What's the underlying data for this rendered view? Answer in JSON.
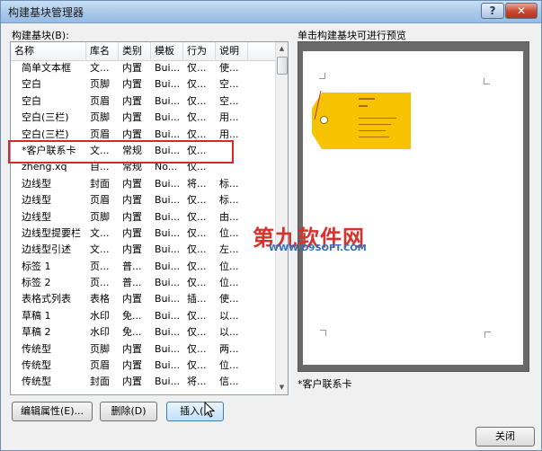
{
  "window": {
    "title": "构建基块管理器",
    "help_label": "?",
    "close_label": "✕"
  },
  "list": {
    "label": "构建基块(B):",
    "columns": [
      "名称",
      "库名",
      "类别",
      "模板",
      "行为",
      "说明"
    ],
    "rows": [
      [
        "简单文本框",
        "文...",
        "内置",
        "Bui...",
        "仅...",
        "使..."
      ],
      [
        "空白",
        "页脚",
        "内置",
        "Bui...",
        "仅...",
        "空..."
      ],
      [
        "空白",
        "页眉",
        "内置",
        "Bui...",
        "仅...",
        "空..."
      ],
      [
        "空白(三栏)",
        "页脚",
        "内置",
        "Bui...",
        "仅...",
        "用..."
      ],
      [
        "空白(三栏)",
        "页眉",
        "内置",
        "Bui...",
        "仅...",
        "用..."
      ],
      [
        "*客户联系卡",
        "文...",
        "常规",
        "Bui...",
        "仅...",
        ""
      ],
      [
        "zheng.xq",
        "自...",
        "常规",
        "No...",
        "仅...",
        ""
      ],
      [
        "边线型",
        "封面",
        "内置",
        "Bui...",
        "将...",
        "标..."
      ],
      [
        "边线型",
        "页眉",
        "内置",
        "Bui...",
        "仅...",
        "标..."
      ],
      [
        "边线型",
        "页脚",
        "内置",
        "Bui...",
        "仅...",
        "由..."
      ],
      [
        "边线型提要栏",
        "文...",
        "内置",
        "Bui...",
        "仅...",
        "位..."
      ],
      [
        "边线型引述",
        "文...",
        "内置",
        "Bui...",
        "仅...",
        "左..."
      ],
      [
        "标签 1",
        "页...",
        "普...",
        "Bui...",
        "仅...",
        "位..."
      ],
      [
        "标签 2",
        "页...",
        "普...",
        "Bui...",
        "仅...",
        "位..."
      ],
      [
        "表格式列表",
        "表格",
        "内置",
        "Bui...",
        "插...",
        "使..."
      ],
      [
        "草稿 1",
        "水印",
        "免...",
        "Bui...",
        "仅...",
        "以..."
      ],
      [
        "草稿 2",
        "水印",
        "免...",
        "Bui...",
        "仅...",
        "以..."
      ],
      [
        "传统型",
        "页脚",
        "内置",
        "Bui...",
        "仅...",
        "两..."
      ],
      [
        "传统型",
        "页眉",
        "内置",
        "Bui...",
        "仅...",
        "位..."
      ],
      [
        "传统型",
        "封面",
        "内置",
        "Bui...",
        "将...",
        "信..."
      ]
    ]
  },
  "preview": {
    "label": "单击构建基块可进行预览",
    "caption": "*客户联系卡"
  },
  "watermark": {
    "main": "第九软件网",
    "sub": "WWW.D9SOFT.COM"
  },
  "buttons": {
    "edit": "编辑属性(E)...",
    "delete": "删除(D)",
    "insert": "插入(I)",
    "close": "关闭"
  },
  "colors": {
    "highlight": "#d9262c",
    "card": "#f7c300"
  }
}
